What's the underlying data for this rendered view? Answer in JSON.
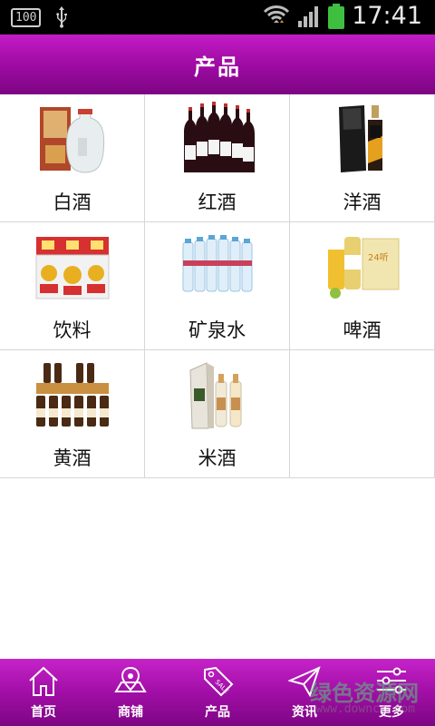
{
  "status": {
    "badge": "100",
    "time": "17:41"
  },
  "header": {
    "title": "产品"
  },
  "products": [
    {
      "label": "白酒",
      "icon": "baijiu-image"
    },
    {
      "label": "红酒",
      "icon": "red-wine-image"
    },
    {
      "label": "洋酒",
      "icon": "whisky-image"
    },
    {
      "label": "饮料",
      "icon": "drinks-image"
    },
    {
      "label": "矿泉水",
      "icon": "mineral-water-image"
    },
    {
      "label": "啤酒",
      "icon": "beer-image"
    },
    {
      "label": "黄酒",
      "icon": "yellow-wine-image"
    },
    {
      "label": "米酒",
      "icon": "rice-wine-image"
    }
  ],
  "tabs": [
    {
      "label": "首页",
      "icon": "home-icon"
    },
    {
      "label": "商铺",
      "icon": "map-store-icon"
    },
    {
      "label": "产品",
      "icon": "sale-tag-icon"
    },
    {
      "label": "资讯",
      "icon": "paper-plane-icon"
    },
    {
      "label": "更多",
      "icon": "sliders-icon"
    }
  ],
  "watermark": {
    "text": "绿色资源网",
    "url": "www.downcc.com"
  },
  "colors": {
    "accent": "#9c0aa0",
    "statusbar": "#000000",
    "battery": "#3fbf3f"
  }
}
